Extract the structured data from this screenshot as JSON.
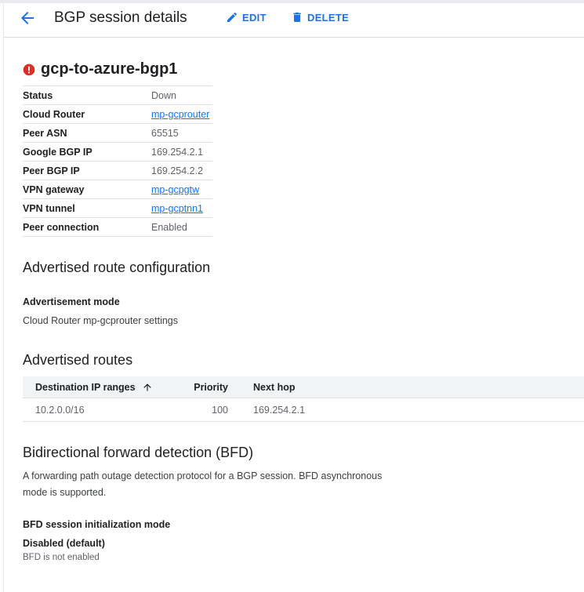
{
  "header": {
    "title": "BGP session details",
    "edit_label": "EDIT",
    "delete_label": "DELETE"
  },
  "session": {
    "name": "gcp-to-azure-bgp1",
    "status_color": "#d93025",
    "properties": [
      {
        "key": "Status",
        "value": "Down",
        "link": false
      },
      {
        "key": "Cloud Router",
        "value": "mp-gcprouter",
        "link": true
      },
      {
        "key": "Peer ASN",
        "value": "65515",
        "link": false
      },
      {
        "key": "Google BGP IP",
        "value": "169.254.2.1",
        "link": false
      },
      {
        "key": "Peer BGP IP",
        "value": "169.254.2.2",
        "link": false
      },
      {
        "key": "VPN gateway",
        "value": "mp-gcpgtw",
        "link": true
      },
      {
        "key": "VPN tunnel",
        "value": "mp-gcptnn1",
        "link": true
      },
      {
        "key": "Peer connection",
        "value": "Enabled",
        "link": false
      }
    ]
  },
  "advertised_config": {
    "heading": "Advertised route configuration",
    "mode_label": "Advertisement mode",
    "mode_value": "Cloud Router mp-gcprouter settings"
  },
  "advertised_routes": {
    "heading": "Advertised routes",
    "columns": [
      "Destination IP ranges",
      "Priority",
      "Next hop"
    ],
    "rows": [
      {
        "dest": "10.2.0.0/16",
        "priority": "100",
        "next_hop": "169.254.2.1"
      }
    ]
  },
  "bfd": {
    "heading": "Bidirectional forward detection (BFD)",
    "description_line1": "A forwarding path outage detection protocol for a BGP session. BFD asynchronous",
    "description_line2": "mode is supported.",
    "init_mode_label": "BFD session initialization mode",
    "init_mode_value": "Disabled (default)",
    "init_mode_note": "BFD is not enabled"
  },
  "colors": {
    "accent": "#1a73e8",
    "error": "#d93025"
  }
}
